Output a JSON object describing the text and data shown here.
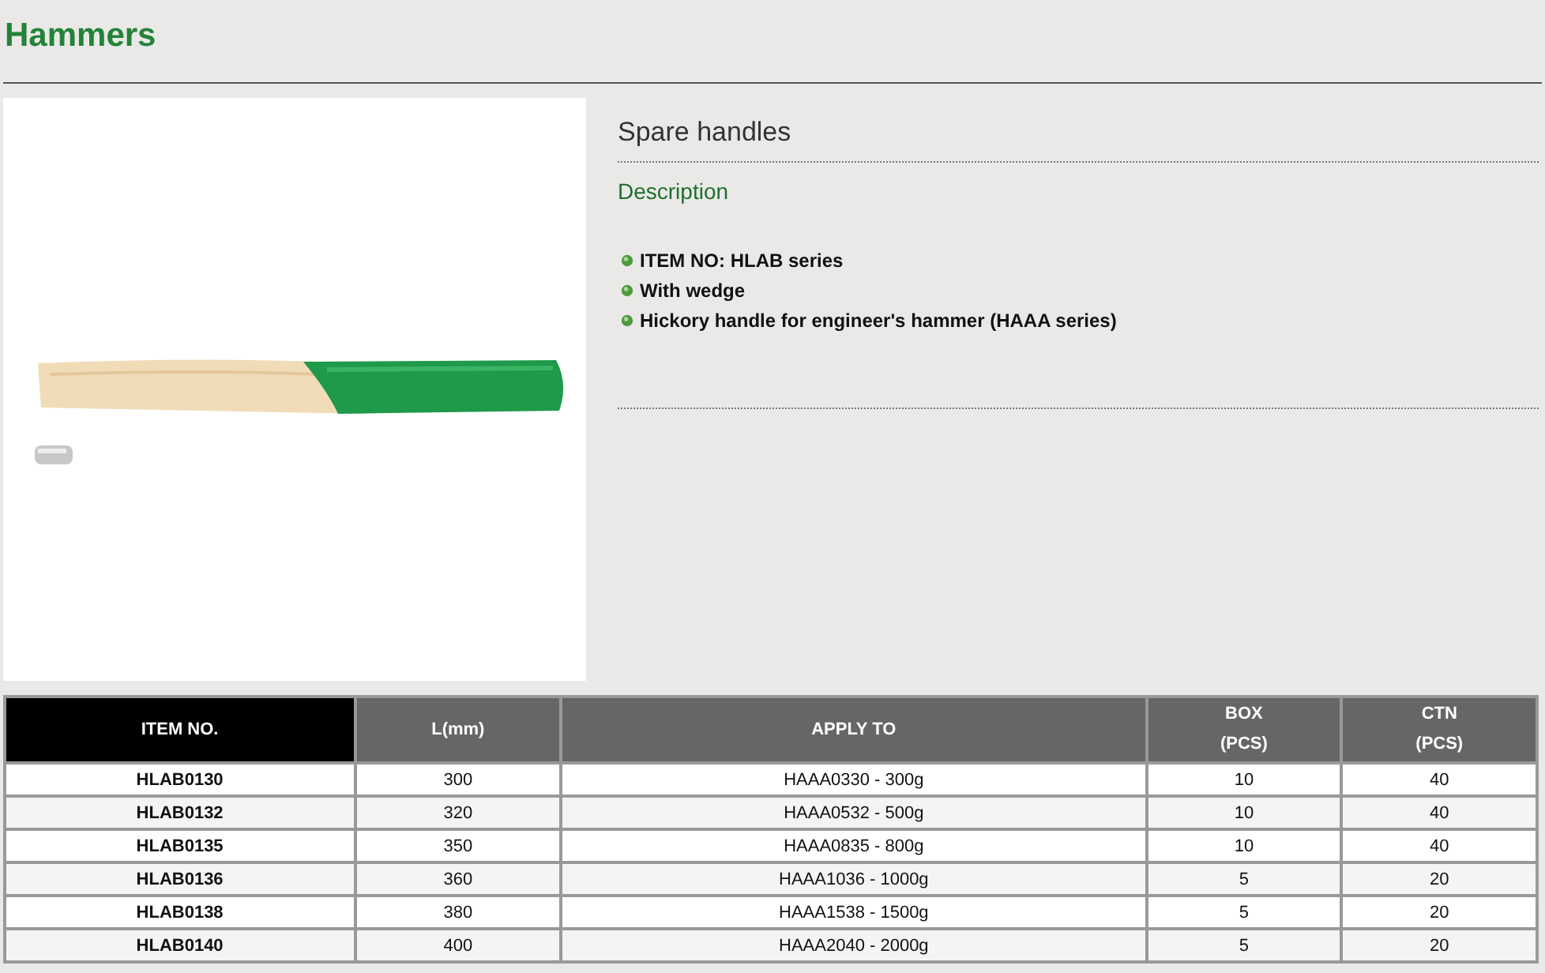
{
  "page_title": "Hammers",
  "product": {
    "name": "Spare handles",
    "section_label": "Description",
    "features": [
      "ITEM NO: HLAB series",
      "With wedge",
      "Hickory handle for engineer's hammer (HAAA series)"
    ]
  },
  "table": {
    "columns": [
      {
        "label": "ITEM NO.",
        "selected": true
      },
      {
        "label": "L(mm)",
        "selected": false
      },
      {
        "label": "APPLY TO",
        "selected": false
      },
      {
        "label": "BOX\n(PCS)",
        "selected": false
      },
      {
        "label": "CTN\n(PCS)",
        "selected": false
      }
    ],
    "rows": [
      [
        "HLAB0130",
        "300",
        "HAAA0330 - 300g",
        "10",
        "40"
      ],
      [
        "HLAB0132",
        "320",
        "HAAA0532 - 500g",
        "10",
        "40"
      ],
      [
        "HLAB0135",
        "350",
        "HAAA0835 - 800g",
        "10",
        "40"
      ],
      [
        "HLAB0136",
        "360",
        "HAAA1036 - 1000g",
        "5",
        "20"
      ],
      [
        "HLAB0138",
        "380",
        "HAAA1538 - 1500g",
        "5",
        "20"
      ],
      [
        "HLAB0140",
        "400",
        "HAAA2040 - 2000g",
        "5",
        "20"
      ]
    ]
  }
}
